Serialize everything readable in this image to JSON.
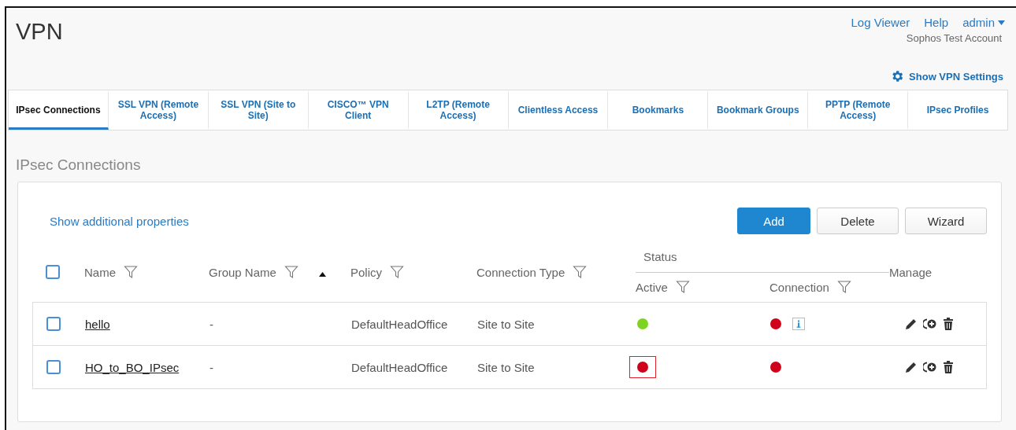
{
  "header": {
    "title": "VPN",
    "links": [
      "Log Viewer",
      "Help"
    ],
    "user": "admin",
    "account": "Sophos Test Account",
    "settings_link": "Show VPN Settings"
  },
  "tabs": [
    {
      "label": "IPsec Connections",
      "selected": true
    },
    {
      "label": "SSL VPN (Remote Access)",
      "selected": false
    },
    {
      "label": "SSL VPN (Site to Site)",
      "selected": false
    },
    {
      "label": "CISCO™ VPN Client",
      "selected": false
    },
    {
      "label": "L2TP (Remote Access)",
      "selected": false
    },
    {
      "label": "Clientless Access",
      "selected": false
    },
    {
      "label": "Bookmarks",
      "selected": false
    },
    {
      "label": "Bookmark Groups",
      "selected": false
    },
    {
      "label": "PPTP (Remote Access)",
      "selected": false
    },
    {
      "label": "IPsec Profiles",
      "selected": false
    }
  ],
  "section_title": "IPsec Connections",
  "panel": {
    "link": "Show additional properties",
    "buttons": [
      {
        "label": "Add",
        "kind": "primary"
      },
      {
        "label": "Delete",
        "kind": "default"
      },
      {
        "label": "Wizard",
        "kind": "default"
      }
    ],
    "table": {
      "header_checked": false,
      "columns": {
        "name": "Name",
        "group_name": "Group Name",
        "policy": "Policy",
        "connection_type": "Connection Type",
        "status": "Status",
        "active": "Active",
        "connection": "Connection",
        "manage": "Manage"
      },
      "rows": [
        {
          "checked": false,
          "name": "hello",
          "group_name": "-",
          "policy": "DefaultHeadOffice",
          "connection_type": "Site to Site",
          "active": {
            "color": "#7ed321",
            "highlighted": false
          },
          "connection": {
            "color": "#d0021b",
            "info": true
          }
        },
        {
          "checked": false,
          "name": "HO_to_BO_IPsec",
          "group_name": "-",
          "policy": "DefaultHeadOffice",
          "connection_type": "Site to Site",
          "active": {
            "color": "#d0021b",
            "highlighted": true
          },
          "connection": {
            "color": "#d0021b",
            "info": false
          }
        }
      ]
    }
  }
}
